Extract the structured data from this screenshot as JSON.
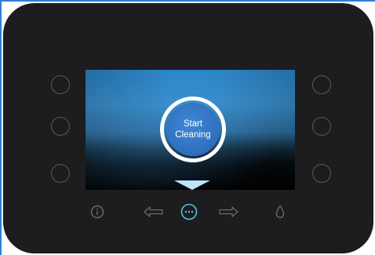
{
  "screen": {
    "start_button": {
      "line1": "Start",
      "line2": "Cleaning"
    },
    "scroll_indicator": "down-arrow"
  },
  "side_buttons": {
    "left": [
      "round-button",
      "round-button",
      "round-button"
    ],
    "right": [
      "round-button",
      "round-button",
      "round-button"
    ]
  },
  "bottom_bar": {
    "icons": [
      "info-icon",
      "arrow-left-icon",
      "more-options-icon",
      "arrow-right-icon",
      "water-drop-icon"
    ]
  },
  "colors": {
    "device_body": "#1d1d1f",
    "button_outline": "#5a5a5d",
    "icon_inactive": "#6d6d70",
    "icon_active": "#4fc3e8",
    "screen_blue": "#2c86c9",
    "start_button_fill": "#2e6fbd",
    "arrow_fill": "#bfe3fb",
    "frame_accent": "#2f7fd6"
  }
}
